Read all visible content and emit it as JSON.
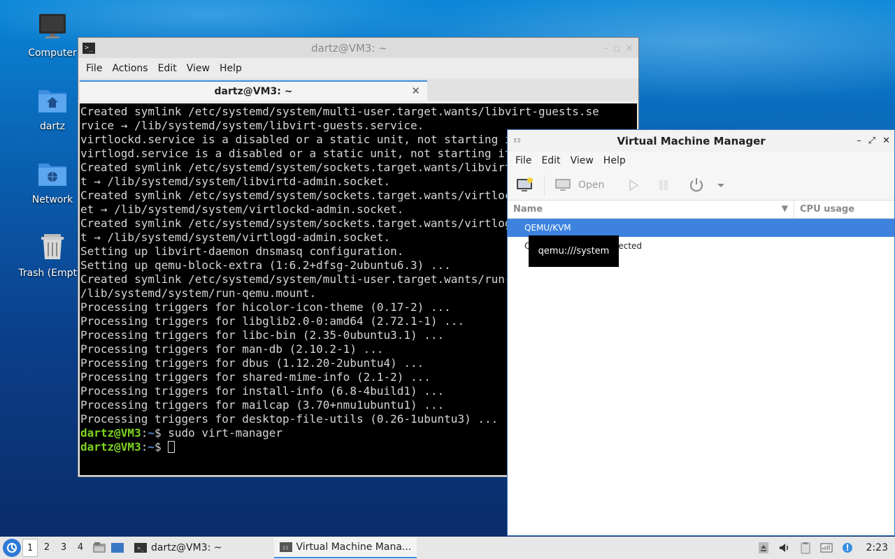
{
  "desktop": {
    "icons": [
      {
        "label": "Computer",
        "icon": "computer-icon"
      },
      {
        "label": "dartz",
        "icon": "home-folder-icon"
      },
      {
        "label": "Network",
        "icon": "network-folder-icon"
      },
      {
        "label": "Trash (Empty)",
        "icon": "trash-icon"
      }
    ]
  },
  "terminal": {
    "window_title": "dartz@VM3: ~",
    "menu": [
      "File",
      "Actions",
      "Edit",
      "View",
      "Help"
    ],
    "tab_title": "dartz@VM3: ~",
    "tab_close": "✕",
    "lines": [
      "Created symlink /etc/systemd/system/multi-user.target.wants/libvirt-guests.se",
      "rvice → /lib/systemd/system/libvirt-guests.service.",
      "virtlockd.service is a disabled or a static unit, not starting it.",
      "virtlogd.service is a disabled or a static unit, not starting it.",
      "Created symlink /etc/systemd/system/sockets.target.wants/libvirtd-admin.socke",
      "t → /lib/systemd/system/libvirtd-admin.socket.",
      "Created symlink /etc/systemd/system/sockets.target.wants/virtlockd-admin.sock",
      "et → /lib/systemd/system/virtlockd-admin.socket.",
      "Created symlink /etc/systemd/system/sockets.target.wants/virtlogd-admin.socke",
      "t → /lib/systemd/system/virtlogd-admin.socket.",
      "Setting up libvirt-daemon dnsmasq configuration.",
      "Setting up qemu-block-extra (1:6.2+dfsg-2ubuntu6.3) ...",
      "Created symlink /etc/systemd/system/multi-user.target.wants/run-qemu.mount →",
      "/lib/systemd/system/run-qemu.mount.",
      "Processing triggers for hicolor-icon-theme (0.17-2) ...",
      "Processing triggers for libglib2.0-0:amd64 (2.72.1-1) ...",
      "Processing triggers for libc-bin (2.35-0ubuntu3.1) ...",
      "Processing triggers for man-db (2.10.2-1) ...",
      "Processing triggers for dbus (1.12.20-2ubuntu4) ...",
      "Processing triggers for shared-mime-info (2.1-2) ...",
      "Processing triggers for install-info (6.8-4build1) ...",
      "Processing triggers for mailcap (3.70+nmu1ubuntu1) ...",
      "Processing triggers for desktop-file-utils (0.26-1ubuntu3) ..."
    ],
    "prompt_user": "dartz@VM3",
    "prompt_sep": ":",
    "prompt_path": "~",
    "prompt_dollar": "$ ",
    "command": "sudo virt-manager"
  },
  "vmm": {
    "window_title": "Virtual Machine Manager",
    "menu": [
      "File",
      "Edit",
      "View",
      "Help"
    ],
    "toolbar": {
      "open_label": "Open"
    },
    "columns": {
      "name": "Name",
      "cpu": "CPU usage"
    },
    "rows": [
      {
        "name": "QEMU/KVM",
        "selected": true
      },
      {
        "name": "QEMU/KVM - Not Connected",
        "selected": false
      }
    ],
    "tooltip": "qemu:///system"
  },
  "taskbar": {
    "workspaces": [
      "1",
      "2",
      "3",
      "4"
    ],
    "tasks": [
      {
        "label": "dartz@VM3: ~",
        "active": false
      },
      {
        "label": "Virtual Machine Mana...",
        "active": true
      }
    ],
    "clock": "2:23"
  }
}
